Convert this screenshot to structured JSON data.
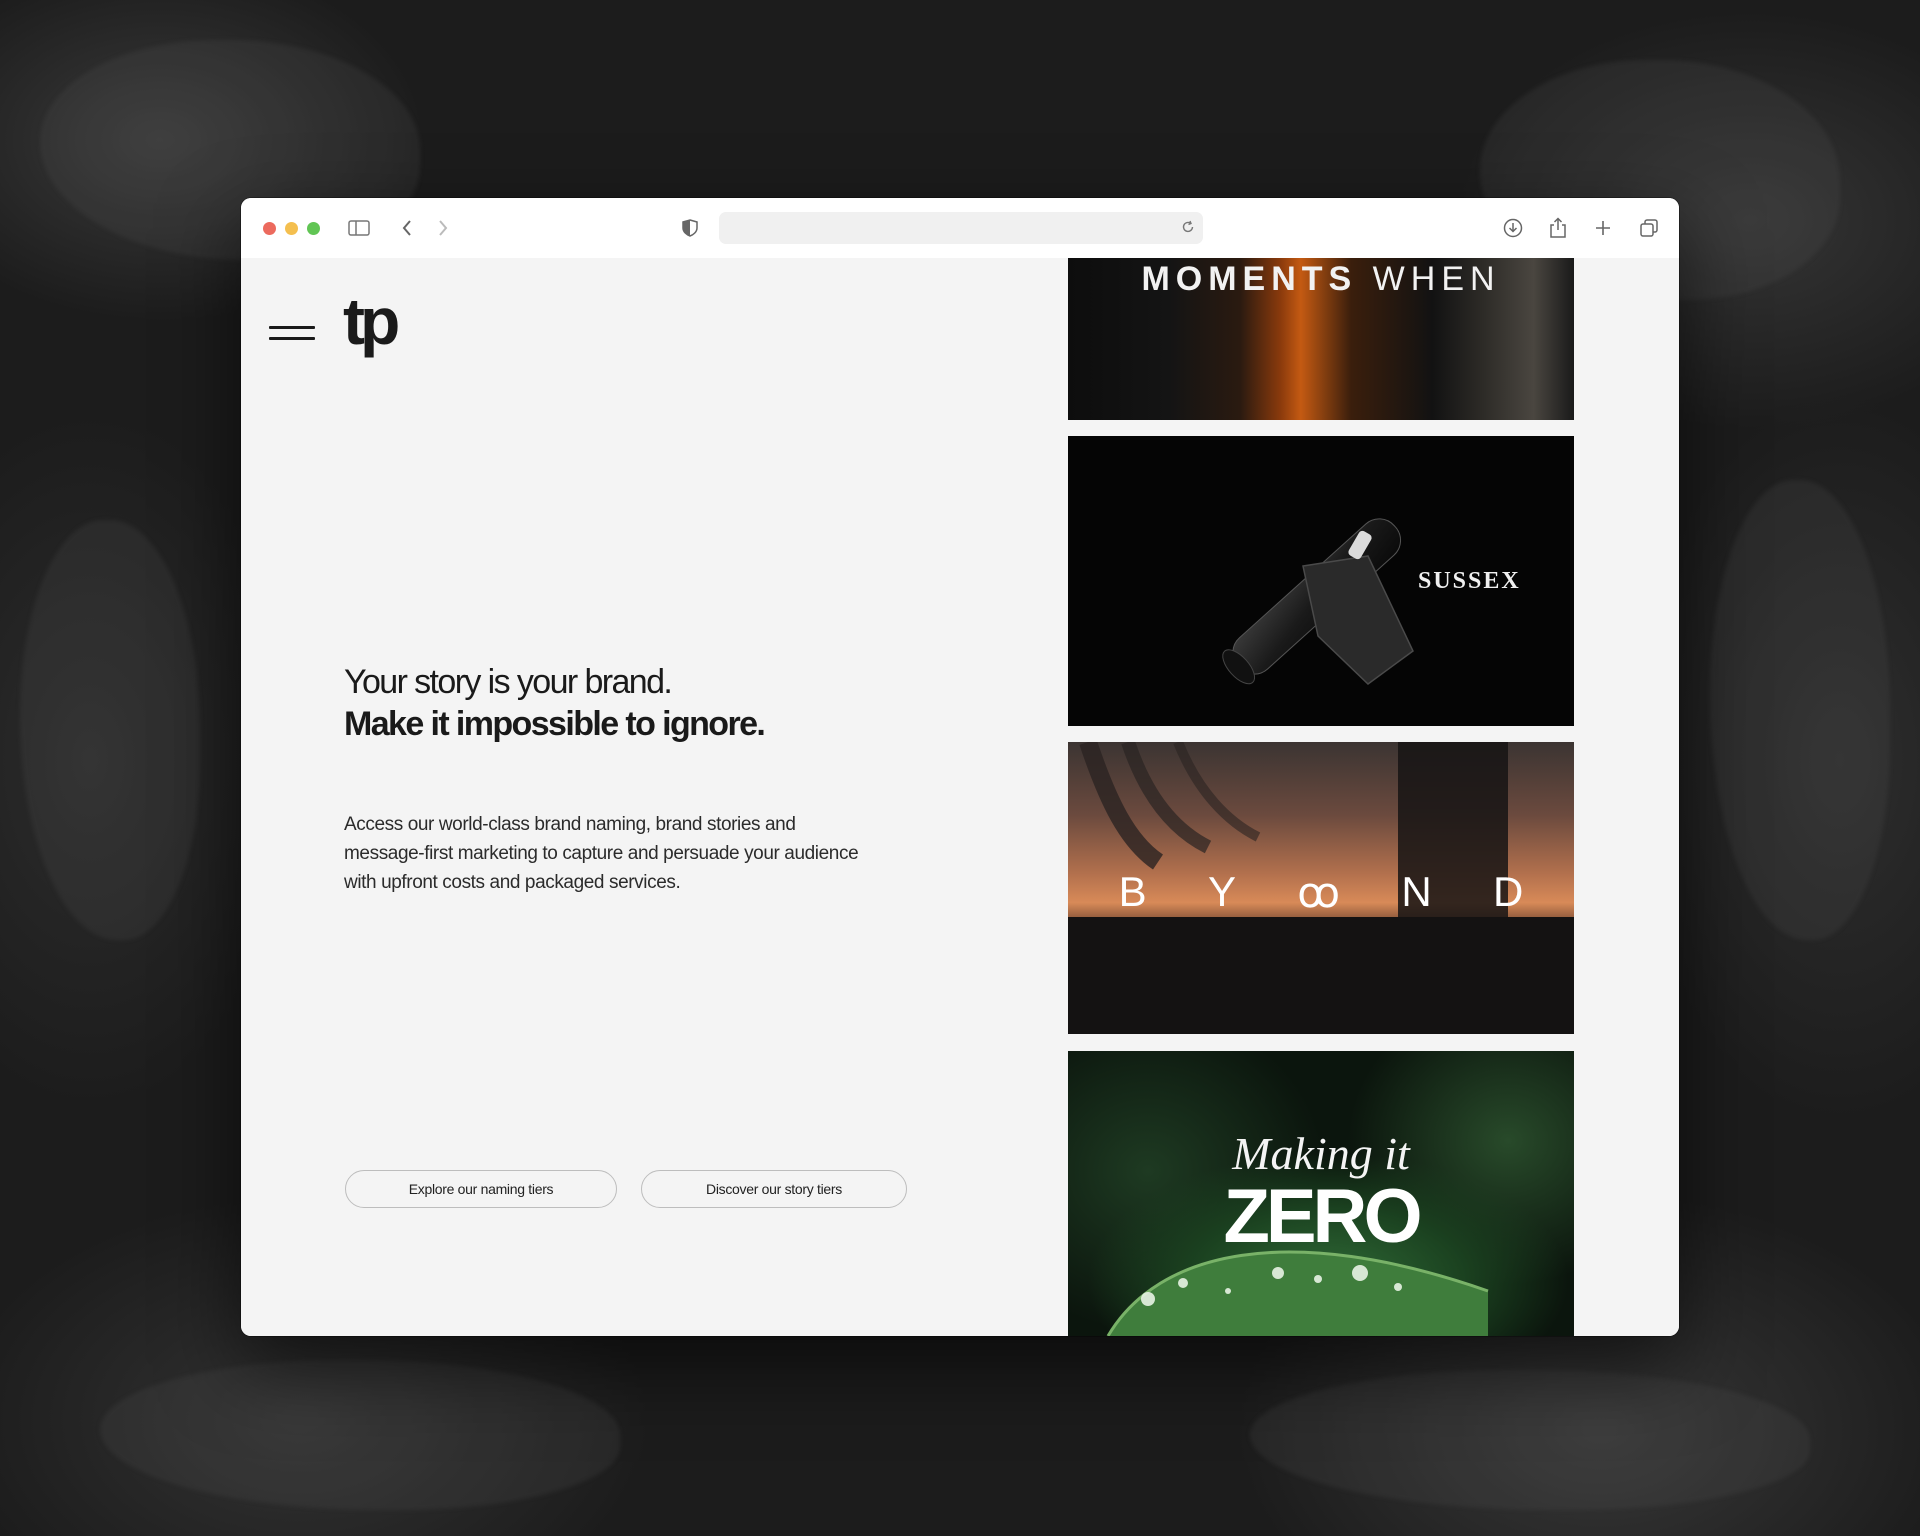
{
  "browser": {
    "traffic_colors": {
      "close": "#ec6a5e",
      "minimize": "#f4bf4f",
      "zoom": "#61c554"
    },
    "url": "",
    "icons": [
      "sidebar-icon",
      "back-icon",
      "forward-icon",
      "shield-icon",
      "reload-icon",
      "download-icon",
      "share-icon",
      "new-tab-icon",
      "tabs-overview-icon"
    ]
  },
  "site": {
    "logo": "tp",
    "hero": {
      "line1": "Your story is your brand.",
      "line2": "Make it impossible to ignore.",
      "body": "Access our world-class brand naming, brand stories and message-first marketing to capture and persuade your audience with upfront costs and packaged services."
    },
    "buttons": {
      "naming": "Explore our naming tiers",
      "story": "Discover our story tiers"
    },
    "portfolio": {
      "moments_bold": "MOMENTS",
      "moments_light": "WHEN",
      "sussex": "SUSSEX",
      "byond": [
        "B",
        "Y",
        "ꝏ",
        "N",
        "D"
      ],
      "making": "Making it",
      "zero": "ZERO"
    }
  },
  "colors": {
    "page_bg": "#f4f4f4",
    "text": "#1a1a1a",
    "button_border": "#bdbdbd"
  }
}
